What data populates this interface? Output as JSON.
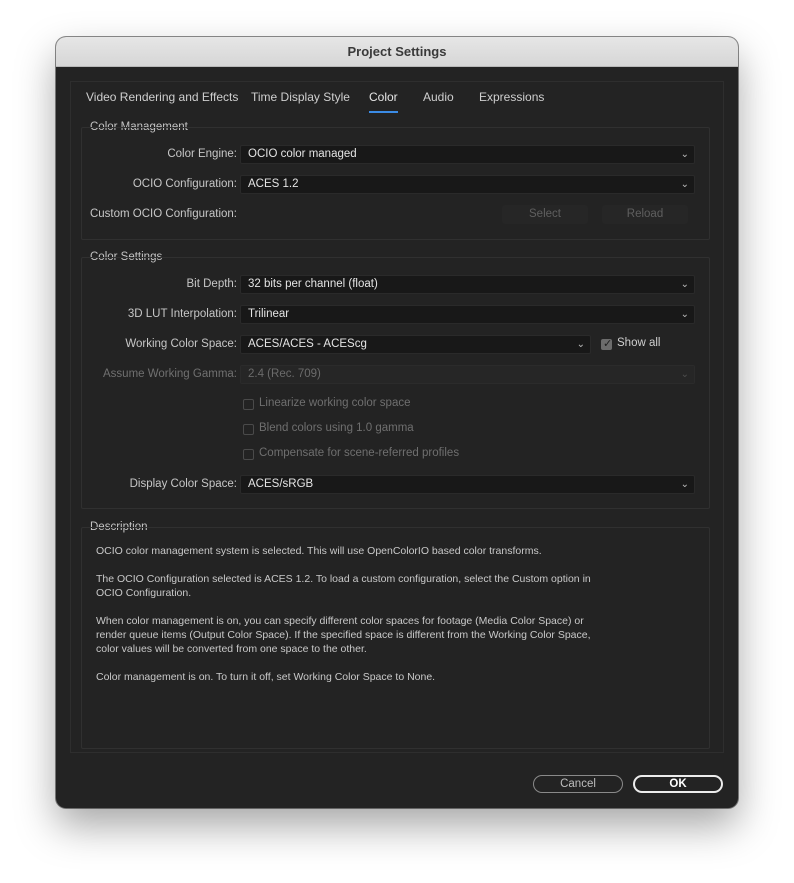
{
  "window": {
    "title": "Project Settings"
  },
  "tabs": [
    {
      "label": "Video Rendering and Effects"
    },
    {
      "label": "Time Display Style"
    },
    {
      "label": "Color"
    },
    {
      "label": "Audio"
    },
    {
      "label": "Expressions"
    }
  ],
  "active_tab": "Color",
  "accent_color": "#3b8be5",
  "color_management": {
    "title": "Color Management",
    "color_engine": {
      "label": "Color Engine:",
      "value": "OCIO color managed"
    },
    "ocio_config": {
      "label": "OCIO Configuration:",
      "value": "ACES 1.2"
    },
    "custom_ocio": {
      "label": "Custom OCIO Configuration:",
      "select_label": "Select",
      "reload_label": "Reload"
    }
  },
  "color_settings": {
    "title": "Color Settings",
    "bit_depth": {
      "label": "Bit Depth:",
      "value": "32 bits per channel (float)"
    },
    "lut_interp": {
      "label": "3D LUT Interpolation:",
      "value": "Trilinear"
    },
    "working_space": {
      "label": "Working Color Space:",
      "value": "ACES/ACES - ACEScg"
    },
    "show_all": {
      "label": "Show all",
      "checked": true
    },
    "working_gamma": {
      "label": "Assume Working Gamma:",
      "value": "2.4 (Rec. 709)"
    },
    "linearize": {
      "label": "Linearize working color space",
      "checked": false
    },
    "blend": {
      "label": "Blend colors using 1.0 gamma",
      "checked": false
    },
    "compensate": {
      "label": "Compensate for scene-referred profiles",
      "checked": false
    },
    "display_space": {
      "label": "Display Color Space:",
      "value": "ACES/sRGB"
    }
  },
  "description": {
    "title": "Description",
    "p1": "OCIO color management system is selected. This will use OpenColorIO based color transforms.",
    "p2": "The OCIO Configuration selected is ACES 1.2. To load a custom configuration, select the Custom option in OCIO Configuration.",
    "p3": "When color management is on, you can specify different color spaces for footage (Media Color Space) or render queue items (Output Color Space). If the specified space is different from the Working Color Space, color values will be converted from one space to the other.",
    "p4": "Color management is on. To turn it off, set Working Color Space to None."
  },
  "footer": {
    "cancel_label": "Cancel",
    "ok_label": "OK"
  }
}
